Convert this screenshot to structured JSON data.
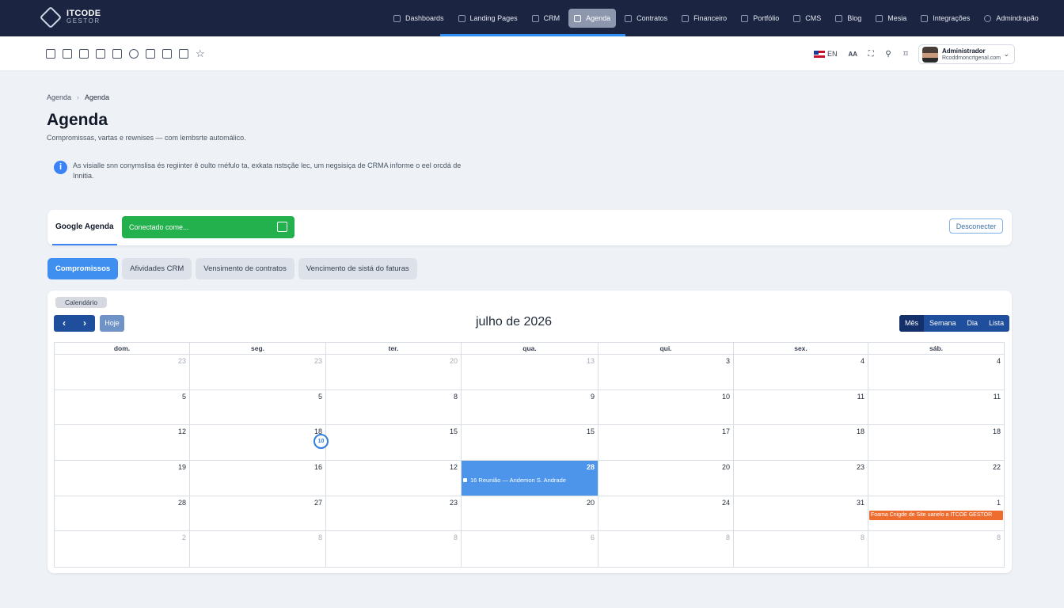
{
  "brand": {
    "line1": "ITCODE",
    "line2": "GESTOR"
  },
  "nav": [
    {
      "label": "Dashboards",
      "icon": "dashboard-icon"
    },
    {
      "label": "Landing Pages",
      "icon": "megaphone-icon"
    },
    {
      "label": "CRM",
      "icon": "crm-icon"
    },
    {
      "label": "Agenda",
      "icon": "calendar-icon",
      "active": true
    },
    {
      "label": "Contratos",
      "icon": "contract-icon"
    },
    {
      "label": "Financeiro",
      "icon": "finance-icon"
    },
    {
      "label": "Portfólio",
      "icon": "portfolio-icon"
    },
    {
      "label": "CMS",
      "icon": "cms-icon"
    },
    {
      "label": "Blog",
      "icon": "blog-icon"
    },
    {
      "label": "Mesia",
      "icon": "folder-icon"
    },
    {
      "label": "Integrações",
      "icon": "integration-icon"
    },
    {
      "label": "Admindrapão",
      "icon": "admin-icon"
    }
  ],
  "toolbar": {
    "tools": [
      "chart-icon",
      "stamp-icon",
      "document-icon",
      "database-icon",
      "building-icon",
      "globe-icon",
      "book-icon",
      "shield-icon",
      "list-icon",
      "star-icon"
    ],
    "lang": "EN",
    "font_size": "AA",
    "user": {
      "name": "Administrador",
      "email": "Rcoddmoncrtgenal.com"
    }
  },
  "breadcrumb": {
    "root": "Agenda",
    "current": "Agenda"
  },
  "page": {
    "title": "Agenda",
    "subtitle": "Compromissas, vartas e rewnises — com lembsrte automálico.",
    "info": "As visialle snn conymslisa és regiinter ê oulto rnéfulo ta, exkata nstsçãe lec, um negsisiça de CRMA informe o eel orcdá de Innitia."
  },
  "google": {
    "tab": "Google Agenda",
    "status": "Conectado come...",
    "disconnect": "Desconecter"
  },
  "tabs": [
    "Compromissos",
    "Afividades CRM",
    "Vensimento de contratos",
    "Vencimento de sistá do faturas"
  ],
  "calendar": {
    "label": "Calendário",
    "prev": "‹",
    "next": "›",
    "today": "Hoje",
    "title": "julho de 2026",
    "views": [
      "Mês",
      "Semana",
      "Dia",
      "Lista"
    ],
    "weekdays": [
      "dom.",
      "seg.",
      "ter.",
      "qua.",
      "qui.",
      "sex.",
      "sáb."
    ],
    "weeks": [
      [
        "23",
        "23",
        "20",
        "13",
        "3",
        "4",
        "4"
      ],
      [
        "5",
        "5",
        "8",
        "9",
        "10",
        "11",
        "11"
      ],
      [
        "12",
        "18",
        "15",
        "15",
        "17",
        "18",
        "18"
      ],
      [
        "19",
        "16",
        "12",
        "28",
        "20",
        "23",
        "22"
      ],
      [
        "28",
        "27",
        "23",
        "20",
        "24",
        "31",
        "1"
      ],
      [
        "2",
        "8",
        "8",
        "6",
        "8",
        "8",
        "8"
      ]
    ],
    "today_marker": "10",
    "events": {
      "blue": "16 Reunião — Andemon S. Andrade",
      "orange": "Foama Cnigde de Site uanelo a ITCOE GESTOR"
    }
  }
}
